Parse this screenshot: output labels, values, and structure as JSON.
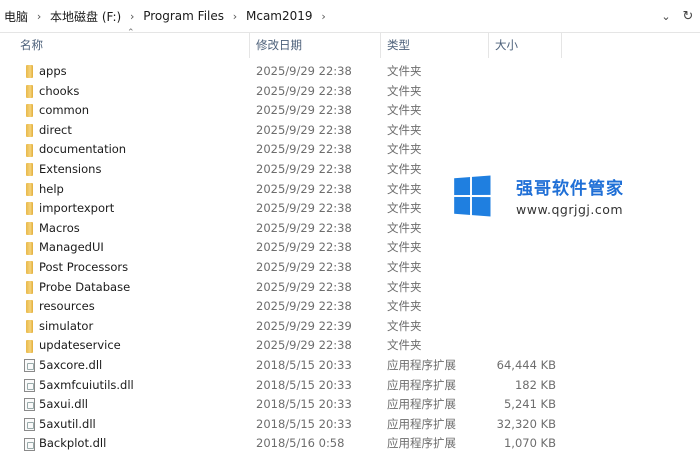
{
  "address": {
    "crumbs": [
      "电脑",
      "本地磁盘 (F:)",
      "Program Files",
      "Mcam2019"
    ],
    "dropdown_icon": "chevron-down-icon",
    "refresh_icon": "refresh-icon"
  },
  "columns": {
    "name": "名称",
    "date": "修改日期",
    "type": "类型",
    "size": "大小"
  },
  "rows": [
    {
      "name": "apps",
      "date": "2025/9/29 22:38",
      "type": "文件夹",
      "size": "",
      "kind": "folder"
    },
    {
      "name": "chooks",
      "date": "2025/9/29 22:38",
      "type": "文件夹",
      "size": "",
      "kind": "folder"
    },
    {
      "name": "common",
      "date": "2025/9/29 22:38",
      "type": "文件夹",
      "size": "",
      "kind": "folder"
    },
    {
      "name": "direct",
      "date": "2025/9/29 22:38",
      "type": "文件夹",
      "size": "",
      "kind": "folder"
    },
    {
      "name": "documentation",
      "date": "2025/9/29 22:38",
      "type": "文件夹",
      "size": "",
      "kind": "folder"
    },
    {
      "name": "Extensions",
      "date": "2025/9/29 22:38",
      "type": "文件夹",
      "size": "",
      "kind": "folder"
    },
    {
      "name": "help",
      "date": "2025/9/29 22:38",
      "type": "文件夹",
      "size": "",
      "kind": "folder"
    },
    {
      "name": "importexport",
      "date": "2025/9/29 22:38",
      "type": "文件夹",
      "size": "",
      "kind": "folder"
    },
    {
      "name": "Macros",
      "date": "2025/9/29 22:38",
      "type": "文件夹",
      "size": "",
      "kind": "folder"
    },
    {
      "name": "ManagedUI",
      "date": "2025/9/29 22:38",
      "type": "文件夹",
      "size": "",
      "kind": "folder"
    },
    {
      "name": "Post Processors",
      "date": "2025/9/29 22:38",
      "type": "文件夹",
      "size": "",
      "kind": "folder"
    },
    {
      "name": "Probe Database",
      "date": "2025/9/29 22:38",
      "type": "文件夹",
      "size": "",
      "kind": "folder"
    },
    {
      "name": "resources",
      "date": "2025/9/29 22:38",
      "type": "文件夹",
      "size": "",
      "kind": "folder"
    },
    {
      "name": "simulator",
      "date": "2025/9/29 22:39",
      "type": "文件夹",
      "size": "",
      "kind": "folder"
    },
    {
      "name": "updateservice",
      "date": "2025/9/29 22:38",
      "type": "文件夹",
      "size": "",
      "kind": "folder"
    },
    {
      "name": "5axcore.dll",
      "date": "2018/5/15 20:33",
      "type": "应用程序扩展",
      "size": "64,444 KB",
      "kind": "file"
    },
    {
      "name": "5axmfcuiutils.dll",
      "date": "2018/5/15 20:33",
      "type": "应用程序扩展",
      "size": "182 KB",
      "kind": "file"
    },
    {
      "name": "5axui.dll",
      "date": "2018/5/15 20:33",
      "type": "应用程序扩展",
      "size": "5,241 KB",
      "kind": "file"
    },
    {
      "name": "5axutil.dll",
      "date": "2018/5/15 20:33",
      "type": "应用程序扩展",
      "size": "32,320 KB",
      "kind": "file"
    },
    {
      "name": "Backplot.dll",
      "date": "2018/5/16 0:58",
      "type": "应用程序扩展",
      "size": "1,070 KB",
      "kind": "file"
    }
  ],
  "watermark": {
    "title": "强哥软件管家",
    "url": "www.qgrjgj.com",
    "logo_icon": "windows-logo-icon",
    "color": "#1f7fe0"
  },
  "icons": {
    "folder": "folder-icon",
    "file": "dll-file-icon"
  }
}
